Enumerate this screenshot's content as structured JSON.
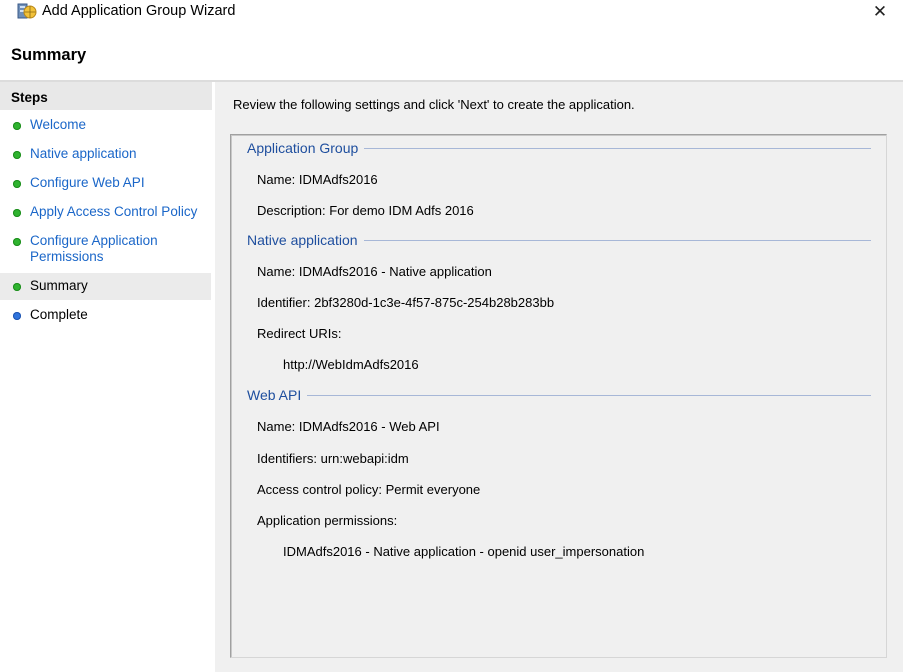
{
  "window": {
    "title": "Add Application Group Wizard",
    "close_glyph": "✕"
  },
  "page_title": "Summary",
  "sidebar": {
    "heading": "Steps",
    "items": [
      {
        "label": "Welcome",
        "status": "done"
      },
      {
        "label": "Native application",
        "status": "done"
      },
      {
        "label": "Configure Web API",
        "status": "done"
      },
      {
        "label": "Apply Access Control Policy",
        "status": "done"
      },
      {
        "label": "Configure Application Permissions",
        "status": "done"
      },
      {
        "label": "Summary",
        "status": "current"
      },
      {
        "label": "Complete",
        "status": "pending"
      }
    ]
  },
  "main": {
    "intro": "Review the following settings and click 'Next' to create the application.",
    "sections": [
      {
        "title": "Application Group",
        "lines": [
          "Name: IDMAdfs2016",
          "Description: For demo IDM Adfs 2016"
        ]
      },
      {
        "title": "Native application",
        "lines": [
          "Name: IDMAdfs2016 - Native application",
          "Identifier: 2bf3280d-1c3e-4f57-875c-254b28b283bb",
          "Redirect URIs:",
          "http://WebIdmAdfs2016"
        ]
      },
      {
        "title": "Web API",
        "lines": [
          "Name: IDMAdfs2016 - Web API",
          "Identifiers: urn:webapi:idm",
          "Access control policy: Permit everyone",
          "Application permissions:",
          "IDMAdfs2016 - Native application - openid user_impersonation"
        ]
      }
    ]
  },
  "colors": {
    "link": "#1a66c8",
    "section_title": "#1e4e9e",
    "done_dot": "#2fb32f",
    "pending_dot": "#2f74dd",
    "content_bg": "#f0f0f0"
  },
  "icons": {
    "app": "server-globe-icon",
    "close": "close-icon",
    "step_done": "green-dot-icon",
    "step_pending": "blue-dot-icon"
  }
}
